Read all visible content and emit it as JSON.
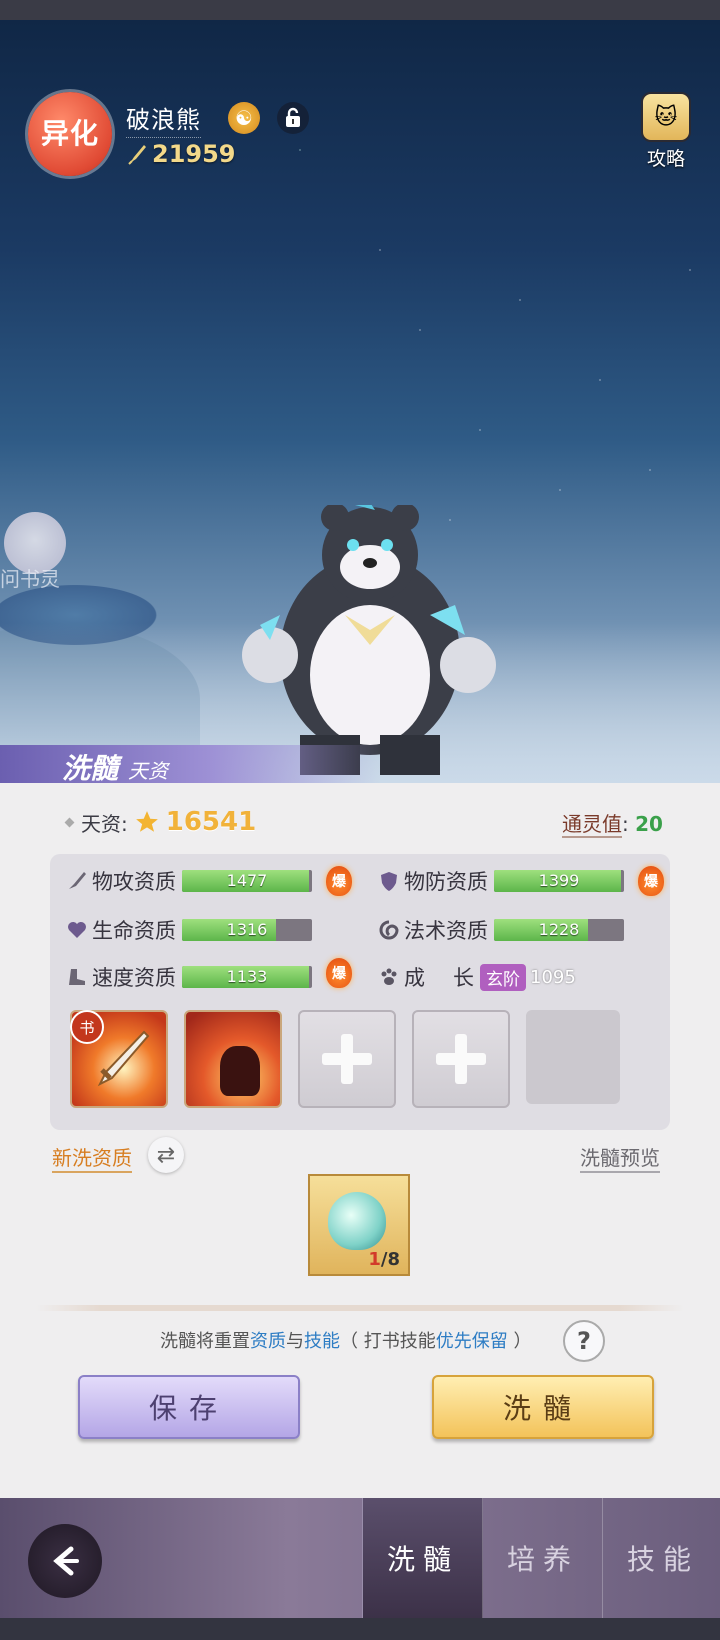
{
  "header": {
    "badge_text": "异化",
    "pet_name": "破浪熊",
    "combat_power": "21959",
    "guide_label": "攻略",
    "helper_label": "问书灵"
  },
  "section": {
    "title_main": "洗髓",
    "title_sub": "天资"
  },
  "talent": {
    "label": "天资:",
    "value": "16541",
    "spirit_label": "通灵值",
    "spirit_sep": ":",
    "spirit_value": "20"
  },
  "stats": [
    {
      "label": "物攻资质",
      "value": "1477",
      "fill": 0.98,
      "burst": true
    },
    {
      "label": "物防资质",
      "value": "1399",
      "fill": 0.98,
      "burst": true
    },
    {
      "label": "生命资质",
      "value": "1316",
      "fill": 0.72,
      "burst": false
    },
    {
      "label": "法术资质",
      "value": "1228",
      "fill": 0.72,
      "burst": false
    },
    {
      "label": "速度资质",
      "value": "1133",
      "fill": 0.98,
      "burst": true
    }
  ],
  "burst_label": "爆",
  "growth": {
    "label_1": "成",
    "label_2": "长",
    "tier": "玄阶",
    "value": "1095"
  },
  "skill_book_tag": "书",
  "links": {
    "new_talent": "新洗资质",
    "preview": "洗髓预览"
  },
  "item": {
    "current": "1",
    "total": "/8"
  },
  "notice": {
    "part1": "洗髓将重置",
    "hl1": "资质",
    "part2": "与",
    "hl2": "技能",
    "part3": "（ 打书技能",
    "hl3": "优先保留",
    "part4": " ）"
  },
  "buttons": {
    "save": "保存",
    "wash": "洗髓"
  },
  "tabs": [
    "洗髓",
    "培养",
    "技能"
  ],
  "colors": {
    "accent_gold": "#f1b23a",
    "accent_green": "#3aa04a",
    "link_blue": "#2e7dc4",
    "tier_purple": "#b05fbf"
  }
}
